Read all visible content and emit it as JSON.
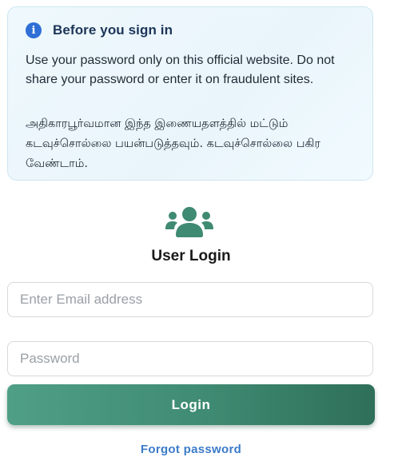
{
  "notice": {
    "icon": "info-icon",
    "icon_glyph": "i",
    "title": "Before you sign in",
    "message_en": "Use your password only on this official website. Do not share your password or enter it on fraudulent sites.",
    "message_ta": "அதிகாரபூர்வமான இந்த இணையதளத்தில் மட்டும் கடவுச்சொல்லை பயன்படுத்தவும். கடவுச்சொல்லை பகிர வேண்டாம்."
  },
  "login": {
    "icon": "users-icon",
    "title": "User Login",
    "email_placeholder": "Enter Email address",
    "password_placeholder": "Password",
    "submit_label": "Login",
    "forgot_label": "Forgot password"
  },
  "colors": {
    "accent": "#3f8a72",
    "link": "#3b7bc8",
    "info": "#2f6fd6"
  }
}
